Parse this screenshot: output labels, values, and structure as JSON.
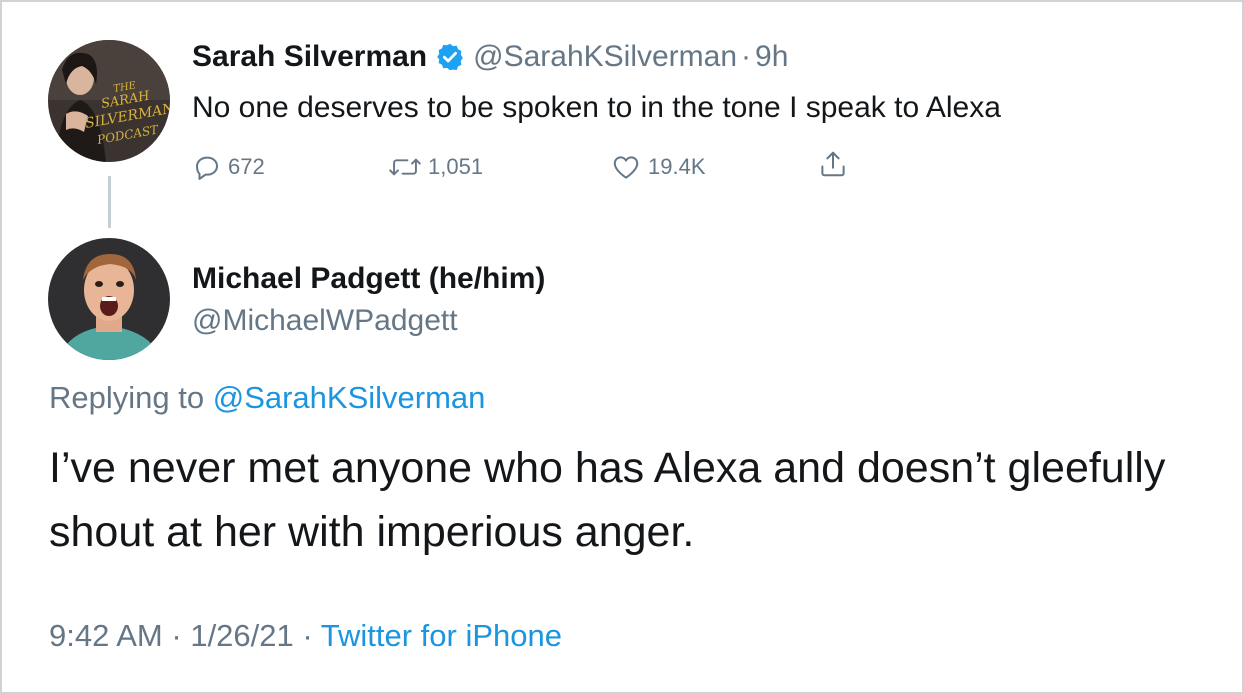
{
  "original_tweet": {
    "author_name": "Sarah Silverman",
    "author_handle": "@SarahKSilverman",
    "separator": "·",
    "age": "9h",
    "text": "No one deserves to be spoken to in the tone I speak to Alexa",
    "avatar_text": [
      "THE",
      "SARAH",
      "SILVERMAN",
      "PODCAST"
    ],
    "actions": {
      "reply_icon": "comment-icon",
      "reply_count": "672",
      "retweet_icon": "retweet-icon",
      "retweet_count": "1,051",
      "like_icon": "heart-icon",
      "like_count": "19.4K",
      "share_icon": "share-icon"
    }
  },
  "reply_tweet": {
    "author_name": "Michael Padgett (he/him)",
    "author_handle": "@MichaelWPadgett",
    "replying_prefix": "Replying to ",
    "replying_to": "@SarahKSilverman",
    "text": "I’ve never met anyone who has Alexa and doesn’t gleefully shout at her with imperious anger.",
    "time": "9:42 AM",
    "date": "1/26/21",
    "separator": "·",
    "source": "Twitter for iPhone"
  },
  "colors": {
    "text": "#14171a",
    "secondary": "#657786",
    "link": "#1b95e0",
    "verified": "#1da1f2",
    "thread_line": "#c4cfd6",
    "podcast_gold": "#d9b23a"
  }
}
